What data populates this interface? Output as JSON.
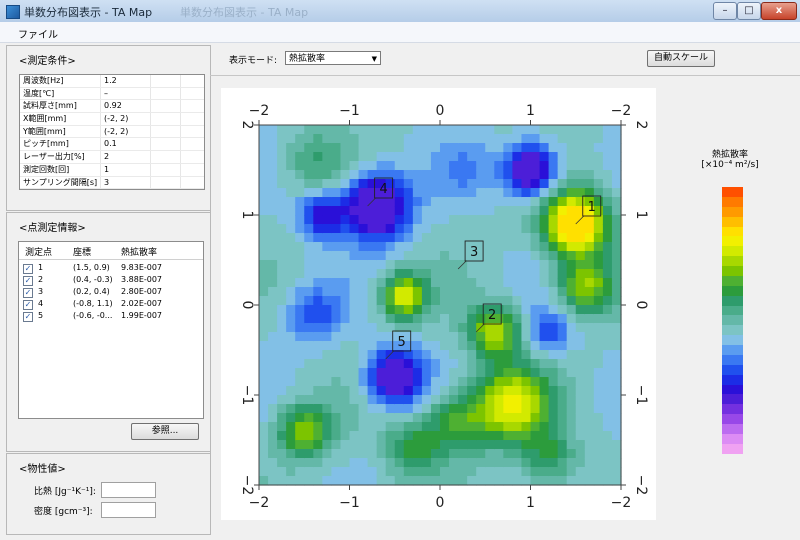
{
  "window": {
    "title": "単数分布図表示 - TA Map",
    "ghost_tab": "単数分布図表示 - TA Map",
    "controls": {
      "minimize": "–",
      "maximize": "□",
      "close": "x"
    }
  },
  "menu": {
    "file": "ファイル"
  },
  "measurement_conditions": {
    "title": "<測定条件>",
    "rows": [
      {
        "label": "周波数[Hz]",
        "value": "1.2"
      },
      {
        "label": "温度[℃]",
        "value": "–"
      },
      {
        "label": "試料厚さ[mm]",
        "value": "0.92"
      },
      {
        "label": "X範囲[mm]",
        "value": "(-2, 2)"
      },
      {
        "label": "Y範囲[mm]",
        "value": "(-2, 2)"
      },
      {
        "label": "ピッチ[mm]",
        "value": "0.1"
      },
      {
        "label": "レーザー出力[%]",
        "value": "2"
      },
      {
        "label": "測定回数[回]",
        "value": "1"
      },
      {
        "label": "サンプリング間隔[s]",
        "value": "3"
      }
    ]
  },
  "point_info": {
    "title": "<点測定情報>",
    "columns": [
      "測定点",
      "座標",
      "熱拡散率"
    ],
    "rows": [
      {
        "id": "1",
        "coord": "(1.5, 0.9)",
        "value": "9.83E-007"
      },
      {
        "id": "2",
        "coord": "(0.4, -0.3)",
        "value": "3.88E-007"
      },
      {
        "id": "3",
        "coord": "(0.2, 0.4)",
        "value": "2.80E-007"
      },
      {
        "id": "4",
        "coord": "(-0.8, 1.1)",
        "value": "2.02E-007"
      },
      {
        "id": "5",
        "coord": "(-0.6, -0...",
        "value": "1.99E-007"
      }
    ],
    "browse_button": "参照..."
  },
  "properties": {
    "title": "<物性値>",
    "specific_heat_label": "比熱 [Jg⁻¹K⁻¹]:",
    "density_label": "密度 [gcm⁻³]:",
    "specific_heat_value": "",
    "density_value": ""
  },
  "toolbar": {
    "mode_label": "表示モード:",
    "mode_value": "熱拡散率",
    "autoscale_button": "自動スケール"
  },
  "chart_data": {
    "type": "heatmap",
    "title": "",
    "xlim": [
      -2,
      2
    ],
    "ylim": [
      -2,
      2
    ],
    "x_ticks": [
      "−2",
      "−1",
      "0",
      "1",
      "−2"
    ],
    "y_ticks": [
      "−2",
      "−1",
      "0",
      "1",
      "2"
    ],
    "colorbar_title": "熱拡散率",
    "colorbar_unit": "[×10⁻⁴ m²/s]",
    "colorbar_colors": [
      "#ff5000",
      "#ff7a00",
      "#ff9a00",
      "#ffbe00",
      "#ffe000",
      "#f2f000",
      "#d2ea00",
      "#a8d800",
      "#7cc400",
      "#4eb032",
      "#2c9c3c",
      "#2e9c6c",
      "#4aac8a",
      "#64b8a8",
      "#7cc4c4",
      "#82c0e6",
      "#5a9cf0",
      "#3a78f2",
      "#2050ee",
      "#1c2ce6",
      "#2a10d8",
      "#4c1ed8",
      "#7430e0",
      "#9848e8",
      "#bc6cf0",
      "#dc8cf4",
      "#f0a2f2"
    ],
    "markers": [
      {
        "label": "1",
        "x": 1.5,
        "y": 0.9
      },
      {
        "label": "2",
        "x": 0.4,
        "y": -0.3
      },
      {
        "label": "3",
        "x": 0.2,
        "y": 0.4
      },
      {
        "label": "4",
        "x": -0.8,
        "y": 1.1
      },
      {
        "label": "5",
        "x": -0.6,
        "y": -0.6
      }
    ],
    "blobs": [
      {
        "x": 1.5,
        "y": 0.9,
        "v": 0.95,
        "r": 0.35
      },
      {
        "x": 1.6,
        "y": 0.2,
        "v": 0.72,
        "r": 0.3
      },
      {
        "x": 0.6,
        "y": -0.3,
        "v": 0.75,
        "r": 0.28
      },
      {
        "x": 0.8,
        "y": -1.1,
        "v": 0.8,
        "r": 0.4
      },
      {
        "x": 0.2,
        "y": -1.3,
        "v": 0.65,
        "r": 0.35
      },
      {
        "x": -0.4,
        "y": 0.1,
        "v": 0.78,
        "r": 0.25
      },
      {
        "x": -1.5,
        "y": -1.4,
        "v": 0.7,
        "r": 0.3
      },
      {
        "x": -0.3,
        "y": -1.6,
        "v": 0.62,
        "r": 0.3
      },
      {
        "x": 1.2,
        "y": -1.7,
        "v": 0.6,
        "r": 0.3
      },
      {
        "x": -1.4,
        "y": 1.6,
        "v": 0.55,
        "r": 0.35
      },
      {
        "x": -0.7,
        "y": 1.1,
        "v": 0.05,
        "r": 0.35
      },
      {
        "x": 1.0,
        "y": 1.5,
        "v": 0.06,
        "r": 0.28
      },
      {
        "x": -0.5,
        "y": -0.8,
        "v": 0.1,
        "r": 0.3
      },
      {
        "x": -1.3,
        "y": 1.0,
        "v": 0.22,
        "r": 0.25
      },
      {
        "x": -1.4,
        "y": -0.1,
        "v": 0.3,
        "r": 0.3
      },
      {
        "x": 1.2,
        "y": -0.3,
        "v": 0.3,
        "r": 0.25
      },
      {
        "x": 0.3,
        "y": 1.5,
        "v": 0.38,
        "r": 0.3
      }
    ]
  }
}
